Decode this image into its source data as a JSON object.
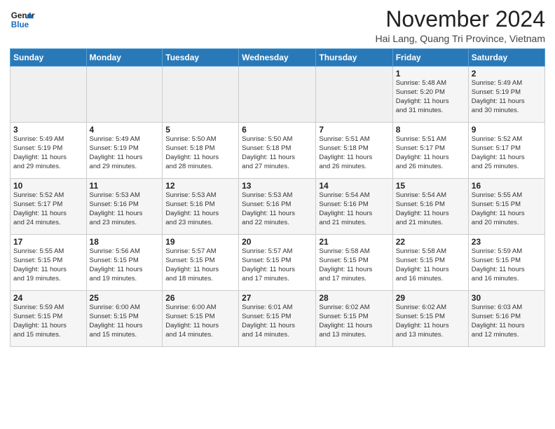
{
  "logo": {
    "line1": "General",
    "line2": "Blue"
  },
  "header": {
    "month": "November 2024",
    "location": "Hai Lang, Quang Tri Province, Vietnam"
  },
  "weekdays": [
    "Sunday",
    "Monday",
    "Tuesday",
    "Wednesday",
    "Thursday",
    "Friday",
    "Saturday"
  ],
  "weeks": [
    [
      {
        "day": "",
        "info": ""
      },
      {
        "day": "",
        "info": ""
      },
      {
        "day": "",
        "info": ""
      },
      {
        "day": "",
        "info": ""
      },
      {
        "day": "",
        "info": ""
      },
      {
        "day": "1",
        "info": "Sunrise: 5:48 AM\nSunset: 5:20 PM\nDaylight: 11 hours\nand 31 minutes."
      },
      {
        "day": "2",
        "info": "Sunrise: 5:49 AM\nSunset: 5:19 PM\nDaylight: 11 hours\nand 30 minutes."
      }
    ],
    [
      {
        "day": "3",
        "info": "Sunrise: 5:49 AM\nSunset: 5:19 PM\nDaylight: 11 hours\nand 29 minutes."
      },
      {
        "day": "4",
        "info": "Sunrise: 5:49 AM\nSunset: 5:19 PM\nDaylight: 11 hours\nand 29 minutes."
      },
      {
        "day": "5",
        "info": "Sunrise: 5:50 AM\nSunset: 5:18 PM\nDaylight: 11 hours\nand 28 minutes."
      },
      {
        "day": "6",
        "info": "Sunrise: 5:50 AM\nSunset: 5:18 PM\nDaylight: 11 hours\nand 27 minutes."
      },
      {
        "day": "7",
        "info": "Sunrise: 5:51 AM\nSunset: 5:18 PM\nDaylight: 11 hours\nand 26 minutes."
      },
      {
        "day": "8",
        "info": "Sunrise: 5:51 AM\nSunset: 5:17 PM\nDaylight: 11 hours\nand 26 minutes."
      },
      {
        "day": "9",
        "info": "Sunrise: 5:52 AM\nSunset: 5:17 PM\nDaylight: 11 hours\nand 25 minutes."
      }
    ],
    [
      {
        "day": "10",
        "info": "Sunrise: 5:52 AM\nSunset: 5:17 PM\nDaylight: 11 hours\nand 24 minutes."
      },
      {
        "day": "11",
        "info": "Sunrise: 5:53 AM\nSunset: 5:16 PM\nDaylight: 11 hours\nand 23 minutes."
      },
      {
        "day": "12",
        "info": "Sunrise: 5:53 AM\nSunset: 5:16 PM\nDaylight: 11 hours\nand 23 minutes."
      },
      {
        "day": "13",
        "info": "Sunrise: 5:53 AM\nSunset: 5:16 PM\nDaylight: 11 hours\nand 22 minutes."
      },
      {
        "day": "14",
        "info": "Sunrise: 5:54 AM\nSunset: 5:16 PM\nDaylight: 11 hours\nand 21 minutes."
      },
      {
        "day": "15",
        "info": "Sunrise: 5:54 AM\nSunset: 5:16 PM\nDaylight: 11 hours\nand 21 minutes."
      },
      {
        "day": "16",
        "info": "Sunrise: 5:55 AM\nSunset: 5:15 PM\nDaylight: 11 hours\nand 20 minutes."
      }
    ],
    [
      {
        "day": "17",
        "info": "Sunrise: 5:55 AM\nSunset: 5:15 PM\nDaylight: 11 hours\nand 19 minutes."
      },
      {
        "day": "18",
        "info": "Sunrise: 5:56 AM\nSunset: 5:15 PM\nDaylight: 11 hours\nand 19 minutes."
      },
      {
        "day": "19",
        "info": "Sunrise: 5:57 AM\nSunset: 5:15 PM\nDaylight: 11 hours\nand 18 minutes."
      },
      {
        "day": "20",
        "info": "Sunrise: 5:57 AM\nSunset: 5:15 PM\nDaylight: 11 hours\nand 17 minutes."
      },
      {
        "day": "21",
        "info": "Sunrise: 5:58 AM\nSunset: 5:15 PM\nDaylight: 11 hours\nand 17 minutes."
      },
      {
        "day": "22",
        "info": "Sunrise: 5:58 AM\nSunset: 5:15 PM\nDaylight: 11 hours\nand 16 minutes."
      },
      {
        "day": "23",
        "info": "Sunrise: 5:59 AM\nSunset: 5:15 PM\nDaylight: 11 hours\nand 16 minutes."
      }
    ],
    [
      {
        "day": "24",
        "info": "Sunrise: 5:59 AM\nSunset: 5:15 PM\nDaylight: 11 hours\nand 15 minutes."
      },
      {
        "day": "25",
        "info": "Sunrise: 6:00 AM\nSunset: 5:15 PM\nDaylight: 11 hours\nand 15 minutes."
      },
      {
        "day": "26",
        "info": "Sunrise: 6:00 AM\nSunset: 5:15 PM\nDaylight: 11 hours\nand 14 minutes."
      },
      {
        "day": "27",
        "info": "Sunrise: 6:01 AM\nSunset: 5:15 PM\nDaylight: 11 hours\nand 14 minutes."
      },
      {
        "day": "28",
        "info": "Sunrise: 6:02 AM\nSunset: 5:15 PM\nDaylight: 11 hours\nand 13 minutes."
      },
      {
        "day": "29",
        "info": "Sunrise: 6:02 AM\nSunset: 5:15 PM\nDaylight: 11 hours\nand 13 minutes."
      },
      {
        "day": "30",
        "info": "Sunrise: 6:03 AM\nSunset: 5:16 PM\nDaylight: 11 hours\nand 12 minutes."
      }
    ]
  ]
}
